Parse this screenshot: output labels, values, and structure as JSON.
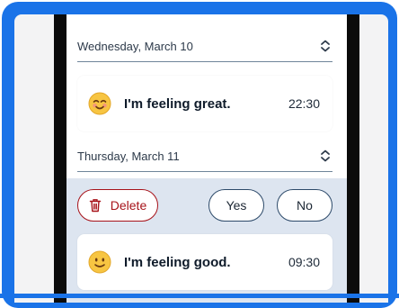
{
  "entries": [
    {
      "date": "Wednesday, March 10",
      "mood": "I'm feeling great.",
      "time": "22:30",
      "emoji_icon": "smiling-face-with-closed-eyes-icon"
    },
    {
      "date": "Thursday, March 11",
      "mood": "I'm feeling good.",
      "time": "09:30",
      "emoji_icon": "slightly-smiling-face-icon"
    }
  ],
  "actions": {
    "delete_label": "Delete",
    "yes_label": "Yes",
    "no_label": "No"
  },
  "colors": {
    "frame_blue": "#1a73e8",
    "delete_red": "#a7131a",
    "selected_band": "#dde5f0"
  }
}
